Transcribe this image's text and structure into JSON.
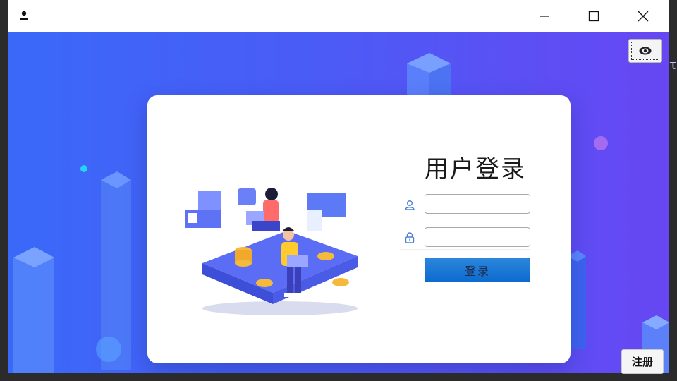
{
  "window": {
    "title_icon": "user-icon",
    "controls": {
      "minimize": "minimize-icon",
      "maximize": "maximize-icon",
      "close": "close-icon"
    }
  },
  "toolbar": {
    "eye_icon": "eye-icon"
  },
  "login": {
    "title": "用户登录",
    "username": {
      "icon": "user-icon",
      "value": "",
      "placeholder": ""
    },
    "password": {
      "icon": "lock-icon",
      "value": "",
      "placeholder": ""
    },
    "submit_label": "登录"
  },
  "register_label": "注册",
  "stray_text": "τ",
  "colors": {
    "bg_start": "#3a69f8",
    "bg_end": "#6747f3",
    "button_blue": "#0d6bcf",
    "icon_blue": "#4a7fd6"
  }
}
